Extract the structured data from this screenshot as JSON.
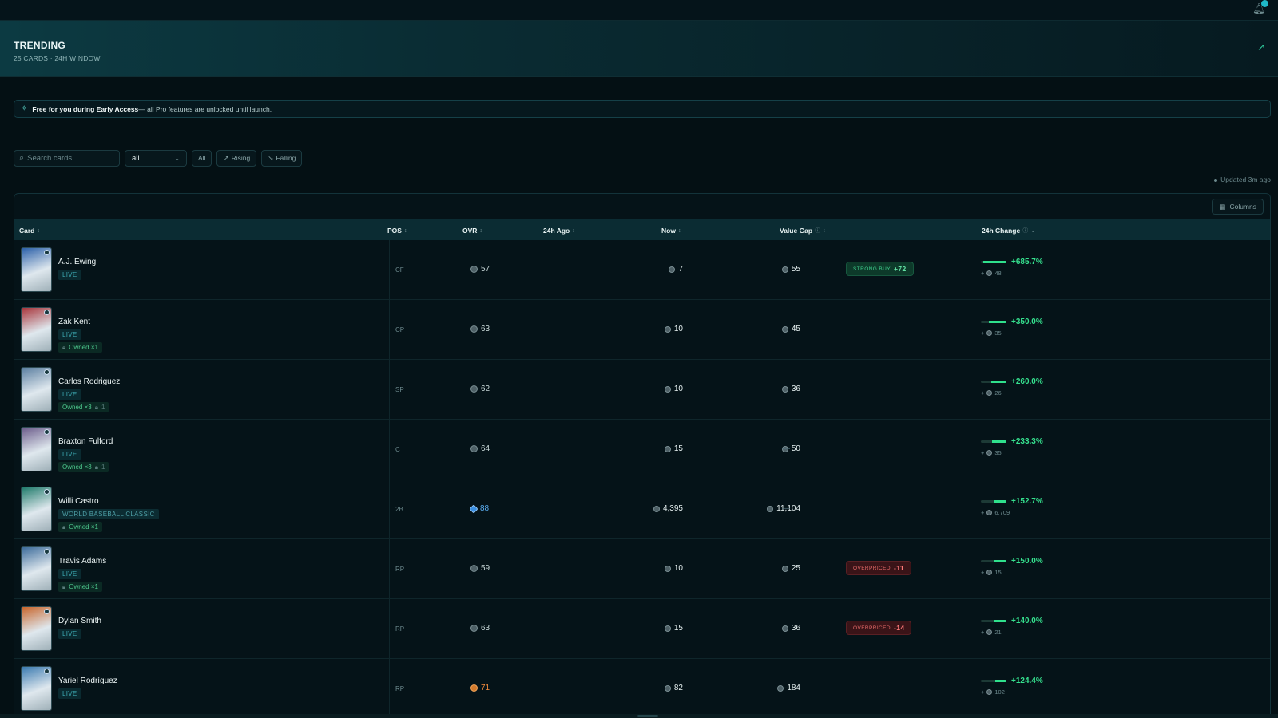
{
  "hero": {
    "title": "TRENDING",
    "subtitle": "25 CARDS · 24H WINDOW"
  },
  "banner": {
    "bold": "Free for you during Early Access",
    "text": " — all Pro features are unlocked until launch."
  },
  "filters": {
    "search_placeholder": "Search cards...",
    "select_value": "all",
    "chips": [
      "All",
      "Rising",
      "Falling"
    ]
  },
  "updated": "Updated 3m ago",
  "columns_label": "Columns",
  "headers": {
    "card": "Card",
    "pos": "POS",
    "ovr": "OVR",
    "ago": "24h Ago",
    "now": "Now",
    "gap": "Value Gap",
    "change": "24h Change"
  },
  "rows": [
    {
      "name": "A.J. Ewing",
      "tag": "LIVE",
      "owned": "",
      "lock": "",
      "pos": "CF",
      "ovr": "57",
      "ago": "7",
      "now": "55",
      "gap": "",
      "gap_label": "STRONG BUY",
      "gap_value": "+72",
      "gap_type": "buy",
      "pct": "+685.7%",
      "delta": "48",
      "fill": 0.9,
      "card_color": "#2a5fa8"
    },
    {
      "name": "Zak Kent",
      "tag": "LIVE",
      "owned": "Owned ×1",
      "lock": "",
      "pos": "CP",
      "ovr": "63",
      "ago": "10",
      "now": "45",
      "gap": "—",
      "gap_label": "",
      "gap_value": "",
      "gap_type": "",
      "pct": "+350.0%",
      "delta": "35",
      "fill": 0.7,
      "card_color": "#a8343a"
    },
    {
      "name": "Carlos Rodriguez",
      "tag": "LIVE",
      "owned": "Owned ×3",
      "lock": "1",
      "pos": "SP",
      "ovr": "62",
      "ago": "10",
      "now": "36",
      "gap": "—",
      "gap_label": "",
      "gap_value": "",
      "gap_type": "",
      "pct": "+260.0%",
      "delta": "26",
      "fill": 0.6,
      "card_color": "#5a7ea0"
    },
    {
      "name": "Braxton Fulford",
      "tag": "LIVE",
      "owned": "Owned ×3",
      "lock": "1",
      "pos": "C",
      "ovr": "64",
      "ago": "15",
      "now": "50",
      "gap": "—",
      "gap_label": "",
      "gap_value": "",
      "gap_type": "",
      "pct": "+233.3%",
      "delta": "35",
      "fill": 0.55,
      "card_color": "#6a5a8a"
    },
    {
      "name": "Willi Castro",
      "tag": "WORLD BASEBALL CLASSIC",
      "owned": "Owned ×1",
      "lock": "",
      "pos": "2B",
      "ovr": "88",
      "ovr_style": "diamond",
      "ago": "4,395",
      "now": "11,104",
      "gap": "—",
      "gap_label": "",
      "gap_value": "",
      "gap_type": "",
      "pct": "+152.7%",
      "delta": "6,709",
      "fill": 0.5,
      "card_color": "#1e7a6a"
    },
    {
      "name": "Travis Adams",
      "tag": "LIVE",
      "owned": "Owned ×1",
      "lock": "",
      "pos": "RP",
      "ovr": "59",
      "ago": "10",
      "now": "25",
      "gap": "",
      "gap_label": "OVERPRICED",
      "gap_value": "-11",
      "gap_type": "over",
      "pct": "+150.0%",
      "delta": "15",
      "fill": 0.5,
      "card_color": "#3a6a9a"
    },
    {
      "name": "Dylan Smith",
      "tag": "LIVE",
      "owned": "",
      "lock": "",
      "pos": "RP",
      "ovr": "63",
      "ago": "15",
      "now": "36",
      "gap": "",
      "gap_label": "OVERPRICED",
      "gap_value": "-14",
      "gap_type": "over",
      "pct": "+140.0%",
      "delta": "21",
      "fill": 0.5,
      "card_color": "#c8642a"
    },
    {
      "name": "Yariel Rodríguez",
      "tag": "LIVE",
      "owned": "",
      "lock": "",
      "pos": "RP",
      "ovr": "71",
      "ovr_style": "gold",
      "ago": "82",
      "now": "184",
      "gap": "—",
      "gap_label": "",
      "gap_value": "",
      "gap_type": "",
      "pct": "+124.4%",
      "delta": "102",
      "fill": 0.45,
      "card_color": "#3a7ab0"
    }
  ],
  "colors": {
    "accent": "#35e08e",
    "overpriced": "#e56a6a",
    "header_bg": "#0b2c33"
  }
}
